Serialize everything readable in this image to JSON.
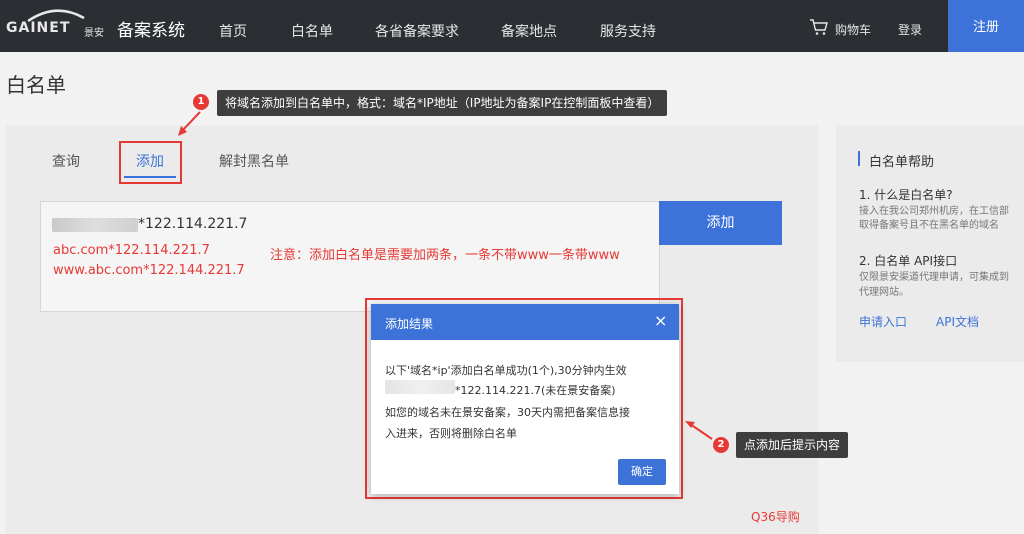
{
  "nav": {
    "logo_text": "GAINET",
    "logo_cn": "景安",
    "system_title": "备案系统",
    "items": [
      {
        "label": "首页"
      },
      {
        "label": "白名单"
      },
      {
        "label": "各省备案要求"
      },
      {
        "label": "备案地点"
      },
      {
        "label": "服务支持"
      }
    ],
    "cart_label": "购物车",
    "login_label": "登录",
    "register_label": "注册"
  },
  "page": {
    "title": "白名单"
  },
  "tabs": [
    {
      "label": "查询"
    },
    {
      "label": "添加"
    },
    {
      "label": "解封黑名单"
    }
  ],
  "form": {
    "input_line1_visible": "*122.114.221.7",
    "example_line1": "abc.com*122.114.221.7",
    "example_line2": "www.abc.com*122.144.221.7",
    "notice": "注意：添加白名单是需要加两条，一条不带www一条带www",
    "add_button": "添加"
  },
  "annotations": [
    {
      "number": "1",
      "text": "将域名添加到白名单中，格式：域名*IP地址（IP地址为备案IP在控制面板中查看）"
    },
    {
      "number": "2",
      "text": "点添加后提示内容"
    }
  ],
  "help": {
    "title": "白名单帮助",
    "q1": "1. 什么是白名单?",
    "a1_line1": "接入在我公司郑州机房，在工信部",
    "a1_line2": "取得备案号且不在黑名单的域名",
    "q2": "2. 白名单 API接口",
    "a2_line1": "仅限景安渠道代理申请，可集成到",
    "a2_line2": "代理网站。",
    "link_apply": "申请入口",
    "link_api": "API文档"
  },
  "modal": {
    "title": "添加结果",
    "close": "×",
    "line1": "以下'域名*ip'添加白名单成功(1个),30分钟内生效",
    "line2_visible": "*122.114.221.7(未在景安备案)",
    "line3": "如您的域名未在景安备案，30天内需把备案信息接",
    "line4": "入进来，否则将删除白名单",
    "ok_button": "确定"
  },
  "watermark": "Q36导购",
  "colors": {
    "nav_bg": "#2b2f33",
    "accent": "#3d73d9",
    "annotation_red": "#e53935"
  }
}
